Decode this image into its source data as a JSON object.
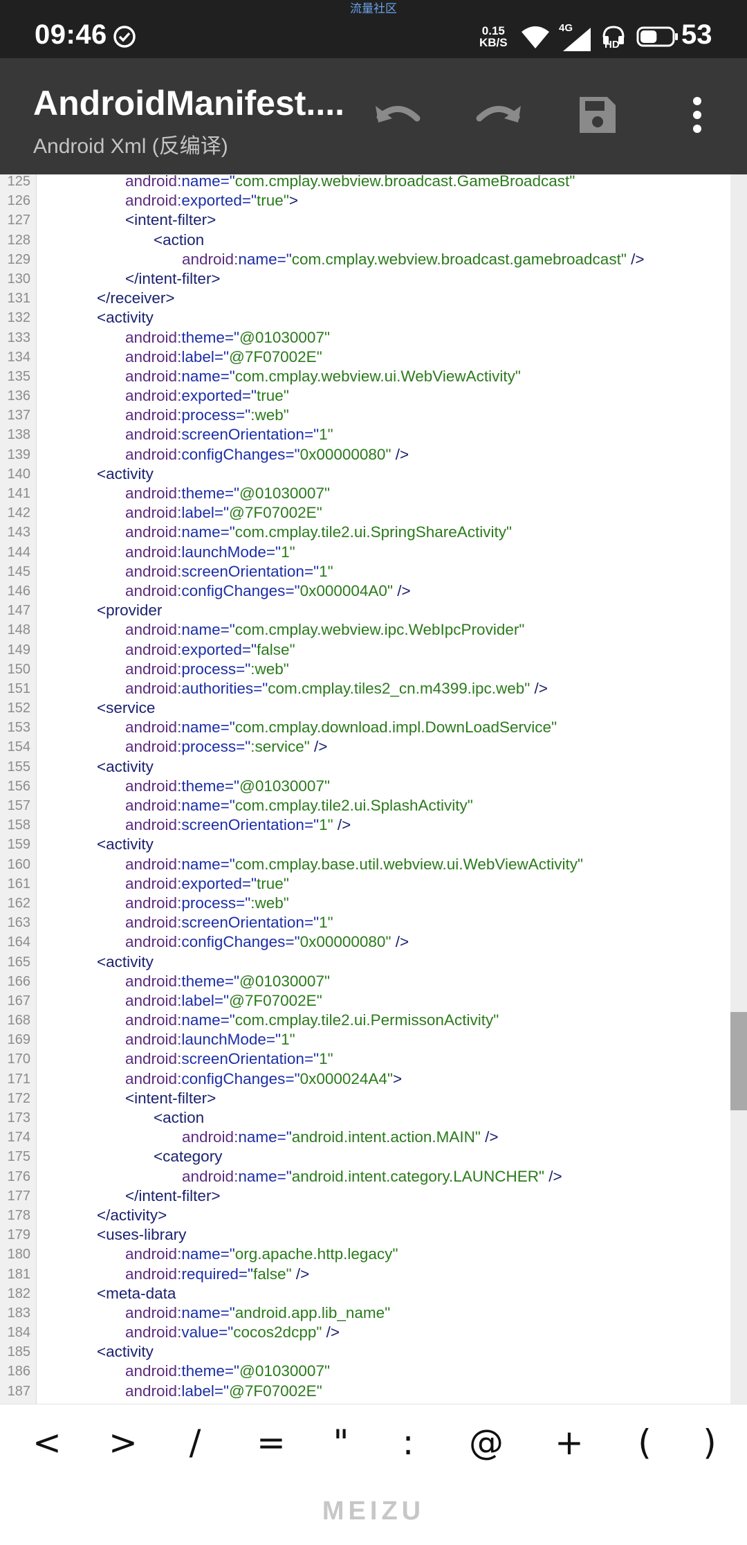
{
  "status_bar": {
    "carrier_note": "流量社区",
    "time": "09:46",
    "net_speed_value": "0.15",
    "net_speed_unit": "KB/S",
    "network_type": "4G",
    "hd_badge": "HD",
    "battery_level": "53"
  },
  "toolbar": {
    "title": "AndroidManifest....",
    "subtitle": "Android Xml (反编译)",
    "icons": [
      "undo-icon",
      "redo-icon",
      "save-icon",
      "more-vert-icon"
    ]
  },
  "editor": {
    "lines": [
      {
        "n": "125",
        "ind": 3,
        "ns": "android",
        "attr": "name",
        "val": "com.cmplay.webview.broadcast.GameBroadcast",
        "end": ""
      },
      {
        "n": "126",
        "ind": 3,
        "ns": "android",
        "attr": "exported",
        "val": "true",
        "end": ">"
      },
      {
        "n": "127",
        "ind": 3,
        "tag": "<intent-filter>"
      },
      {
        "n": "128",
        "ind": 4,
        "tag": "<action"
      },
      {
        "n": "129",
        "ind": 5,
        "ns": "android",
        "attr": "name",
        "val": "com.cmplay.webview.broadcast.gamebroadcast",
        "end": " />"
      },
      {
        "n": "130",
        "ind": 3,
        "tag": "</intent-filter>"
      },
      {
        "n": "131",
        "ind": 2,
        "tag": "</receiver>"
      },
      {
        "n": "132",
        "ind": 2,
        "tag": "<activity"
      },
      {
        "n": "133",
        "ind": 3,
        "ns": "android",
        "attr": "theme",
        "val": "@01030007",
        "end": ""
      },
      {
        "n": "134",
        "ind": 3,
        "ns": "android",
        "attr": "label",
        "val": "@7F07002E",
        "end": ""
      },
      {
        "n": "135",
        "ind": 3,
        "ns": "android",
        "attr": "name",
        "val": "com.cmplay.webview.ui.WebViewActivity",
        "end": ""
      },
      {
        "n": "136",
        "ind": 3,
        "ns": "android",
        "attr": "exported",
        "val": "true",
        "end": ""
      },
      {
        "n": "137",
        "ind": 3,
        "ns": "android",
        "attr": "process",
        "val": ":web",
        "end": ""
      },
      {
        "n": "138",
        "ind": 3,
        "ns": "android",
        "attr": "screenOrientation",
        "val": "1",
        "end": ""
      },
      {
        "n": "139",
        "ind": 3,
        "ns": "android",
        "attr": "configChanges",
        "val": "0x00000080",
        "end": " />"
      },
      {
        "n": "140",
        "ind": 2,
        "tag": "<activity"
      },
      {
        "n": "141",
        "ind": 3,
        "ns": "android",
        "attr": "theme",
        "val": "@01030007",
        "end": ""
      },
      {
        "n": "142",
        "ind": 3,
        "ns": "android",
        "attr": "label",
        "val": "@7F07002E",
        "end": ""
      },
      {
        "n": "143",
        "ind": 3,
        "ns": "android",
        "attr": "name",
        "val": "com.cmplay.tile2.ui.SpringShareActivity",
        "end": ""
      },
      {
        "n": "144",
        "ind": 3,
        "ns": "android",
        "attr": "launchMode",
        "val": "1",
        "end": ""
      },
      {
        "n": "145",
        "ind": 3,
        "ns": "android",
        "attr": "screenOrientation",
        "val": "1",
        "end": ""
      },
      {
        "n": "146",
        "ind": 3,
        "ns": "android",
        "attr": "configChanges",
        "val": "0x000004A0",
        "end": " />"
      },
      {
        "n": "147",
        "ind": 2,
        "tag": "<provider"
      },
      {
        "n": "148",
        "ind": 3,
        "ns": "android",
        "attr": "name",
        "val": "com.cmplay.webview.ipc.WebIpcProvider",
        "end": ""
      },
      {
        "n": "149",
        "ind": 3,
        "ns": "android",
        "attr": "exported",
        "val": "false",
        "end": ""
      },
      {
        "n": "150",
        "ind": 3,
        "ns": "android",
        "attr": "process",
        "val": ":web",
        "end": ""
      },
      {
        "n": "151",
        "ind": 3,
        "ns": "android",
        "attr": "authorities",
        "val": "com.cmplay.tiles2_cn.m4399.ipc.web",
        "end": " />"
      },
      {
        "n": "152",
        "ind": 2,
        "tag": "<service"
      },
      {
        "n": "153",
        "ind": 3,
        "ns": "android",
        "attr": "name",
        "val": "com.cmplay.download.impl.DownLoadService",
        "end": ""
      },
      {
        "n": "154",
        "ind": 3,
        "ns": "android",
        "attr": "process",
        "val": ":service",
        "end": " />"
      },
      {
        "n": "155",
        "ind": 2,
        "tag": "<activity"
      },
      {
        "n": "156",
        "ind": 3,
        "ns": "android",
        "attr": "theme",
        "val": "@01030007",
        "end": ""
      },
      {
        "n": "157",
        "ind": 3,
        "ns": "android",
        "attr": "name",
        "val": "com.cmplay.tile2.ui.SplashActivity",
        "end": ""
      },
      {
        "n": "158",
        "ind": 3,
        "ns": "android",
        "attr": "screenOrientation",
        "val": "1",
        "end": " />"
      },
      {
        "n": "159",
        "ind": 2,
        "tag": "<activity"
      },
      {
        "n": "160",
        "ind": 3,
        "ns": "android",
        "attr": "name",
        "val": "com.cmplay.base.util.webview.ui.WebViewActivity",
        "end": ""
      },
      {
        "n": "161",
        "ind": 3,
        "ns": "android",
        "attr": "exported",
        "val": "true",
        "end": ""
      },
      {
        "n": "162",
        "ind": 3,
        "ns": "android",
        "attr": "process",
        "val": ":web",
        "end": ""
      },
      {
        "n": "163",
        "ind": 3,
        "ns": "android",
        "attr": "screenOrientation",
        "val": "1",
        "end": ""
      },
      {
        "n": "164",
        "ind": 3,
        "ns": "android",
        "attr": "configChanges",
        "val": "0x00000080",
        "end": " />"
      },
      {
        "n": "165",
        "ind": 2,
        "tag": "<activity"
      },
      {
        "n": "166",
        "ind": 3,
        "ns": "android",
        "attr": "theme",
        "val": "@01030007",
        "end": ""
      },
      {
        "n": "167",
        "ind": 3,
        "ns": "android",
        "attr": "label",
        "val": "@7F07002E",
        "end": ""
      },
      {
        "n": "168",
        "ind": 3,
        "ns": "android",
        "attr": "name",
        "val": "com.cmplay.tile2.ui.PermissonActivity",
        "end": ""
      },
      {
        "n": "169",
        "ind": 3,
        "ns": "android",
        "attr": "launchMode",
        "val": "1",
        "end": ""
      },
      {
        "n": "170",
        "ind": 3,
        "ns": "android",
        "attr": "screenOrientation",
        "val": "1",
        "end": ""
      },
      {
        "n": "171",
        "ind": 3,
        "ns": "android",
        "attr": "configChanges",
        "val": "0x000024A4",
        "end": ">"
      },
      {
        "n": "172",
        "ind": 3,
        "tag": "<intent-filter>"
      },
      {
        "n": "173",
        "ind": 4,
        "tag": "<action"
      },
      {
        "n": "174",
        "ind": 5,
        "ns": "android",
        "attr": "name",
        "val": "android.intent.action.MAIN",
        "end": " />"
      },
      {
        "n": "175",
        "ind": 4,
        "tag": "<category"
      },
      {
        "n": "176",
        "ind": 5,
        "ns": "android",
        "attr": "name",
        "val": "android.intent.category.LAUNCHER",
        "end": " />"
      },
      {
        "n": "177",
        "ind": 3,
        "tag": "</intent-filter>"
      },
      {
        "n": "178",
        "ind": 2,
        "tag": "</activity>"
      },
      {
        "n": "179",
        "ind": 2,
        "tag": "<uses-library"
      },
      {
        "n": "180",
        "ind": 3,
        "ns": "android",
        "attr": "name",
        "val": "org.apache.http.legacy",
        "end": ""
      },
      {
        "n": "181",
        "ind": 3,
        "ns": "android",
        "attr": "required",
        "val": "false",
        "end": " />"
      },
      {
        "n": "182",
        "ind": 2,
        "tag": "<meta-data"
      },
      {
        "n": "183",
        "ind": 3,
        "ns": "android",
        "attr": "name",
        "val": "android.app.lib_name",
        "end": ""
      },
      {
        "n": "184",
        "ind": 3,
        "ns": "android",
        "attr": "value",
        "val": "cocos2dcpp",
        "end": " />"
      },
      {
        "n": "185",
        "ind": 2,
        "tag": "<activity"
      },
      {
        "n": "186",
        "ind": 3,
        "ns": "android",
        "attr": "theme",
        "val": "@01030007",
        "end": ""
      },
      {
        "n": "187",
        "ind": 3,
        "ns": "android",
        "attr": "label",
        "val": "@7F07002E",
        "end": ""
      }
    ]
  },
  "symbol_bar": {
    "keys": [
      "<",
      ">",
      "/",
      "=",
      "\"",
      ":",
      "@",
      "+",
      "(",
      ")"
    ]
  },
  "brand": "MEIZU",
  "colors": {
    "status_bar_bg": "#202020",
    "toolbar_bg": "#383838",
    "namespace": "#5d2c7e",
    "attribute": "#1c2ea8",
    "value": "#2b7a1c",
    "tag": "#1b2170"
  }
}
